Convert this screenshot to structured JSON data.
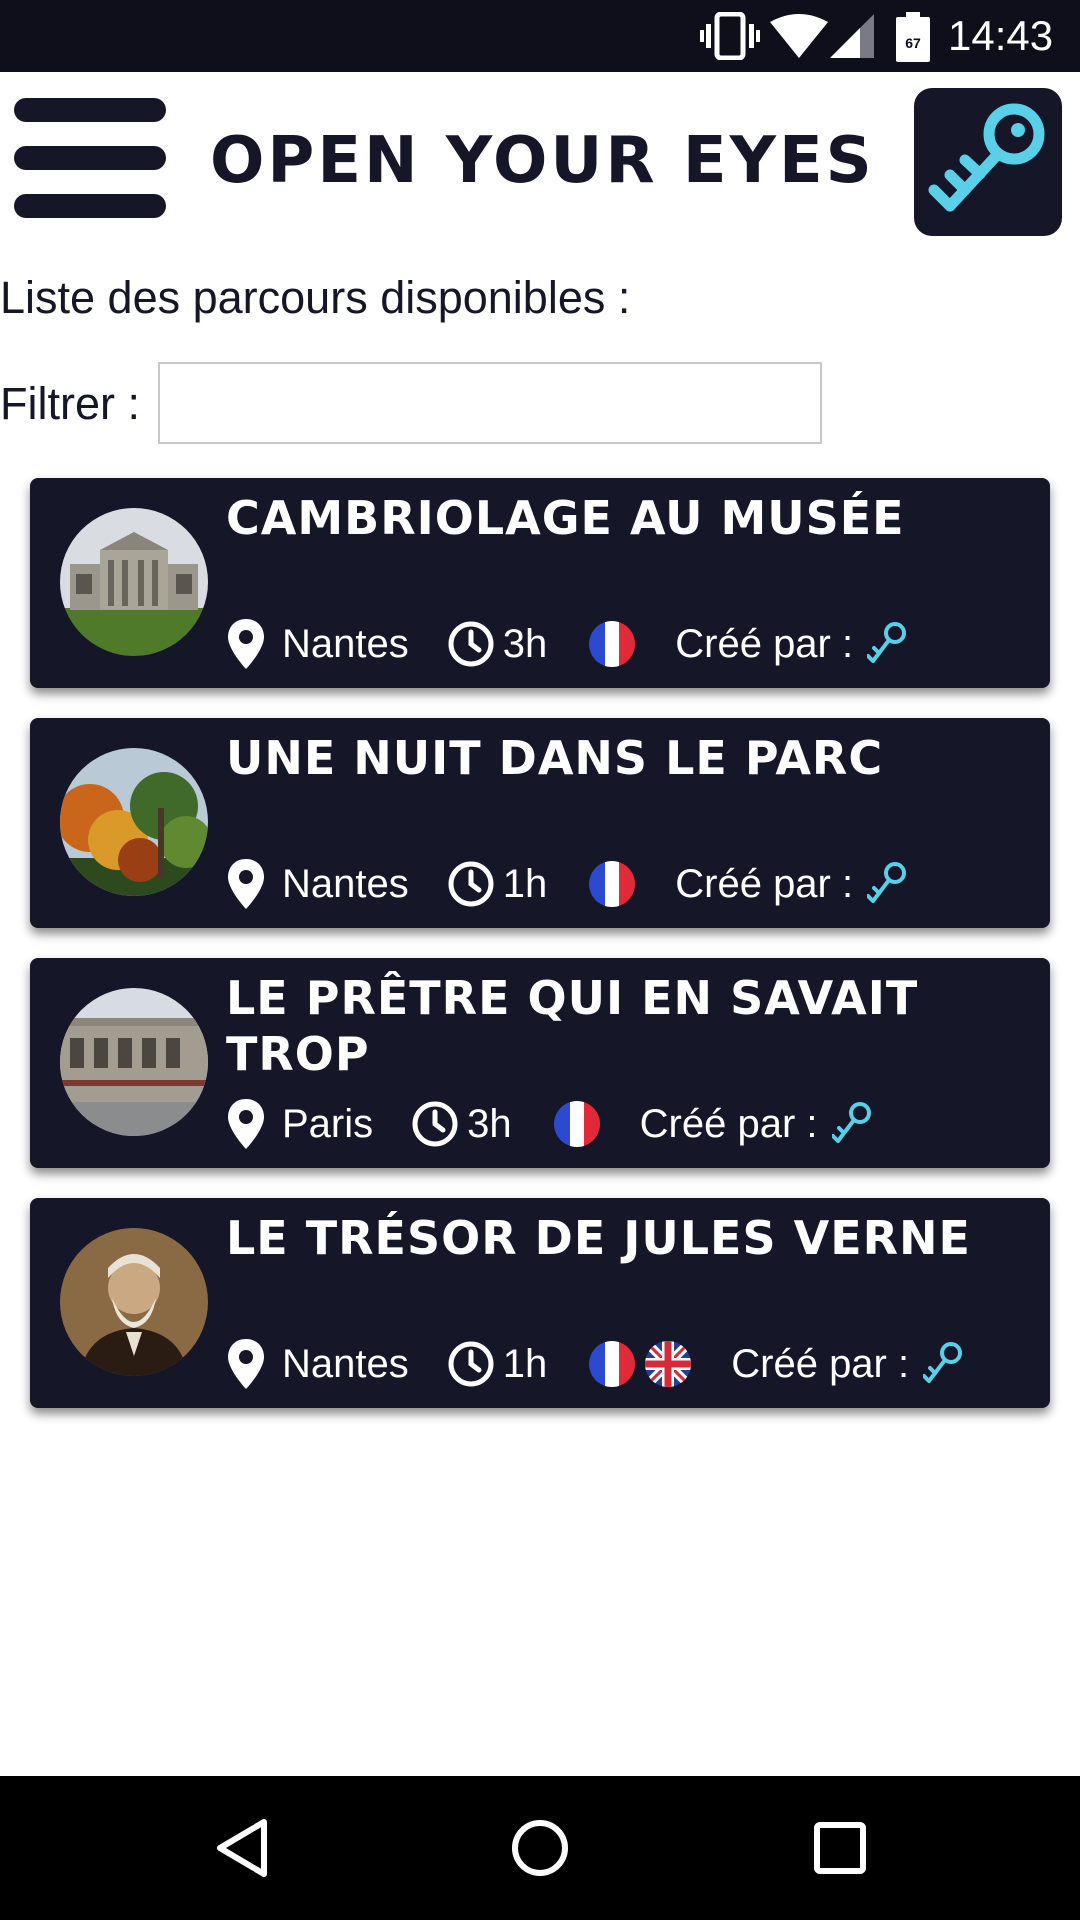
{
  "status_bar": {
    "time": "14:43",
    "battery_level": "67",
    "icons": [
      "vibrate-icon",
      "wifi-icon",
      "signal-icon",
      "battery-icon"
    ]
  },
  "header": {
    "title": "OPEN YOUR EYES",
    "menu_icon": "hamburger-menu-icon",
    "action_icon": "key-icon"
  },
  "list_heading": "Liste des parcours disponibles :",
  "filter": {
    "label": "Filtrer :",
    "value": "",
    "placeholder": ""
  },
  "routes": [
    {
      "title": "CAMBRIOLAGE AU MUSÉE",
      "city": "Nantes",
      "duration": "3h",
      "languages": [
        "fr"
      ],
      "created_by_label": "Créé par :",
      "image": "museum-building-photo"
    },
    {
      "title": "UNE NUIT DANS LE PARC",
      "city": "Nantes",
      "duration": "1h",
      "languages": [
        "fr"
      ],
      "created_by_label": "Créé par :",
      "image": "autumn-park-trees-photo"
    },
    {
      "title": "LE PRÊTRE QUI EN SAVAIT TROP",
      "city": "Paris",
      "duration": "3h",
      "languages": [
        "fr"
      ],
      "created_by_label": "Créé par :",
      "image": "paris-street-building-photo"
    },
    {
      "title": "LE TRÉSOR DE JULES VERNE",
      "city": "Nantes",
      "duration": "1h",
      "languages": [
        "fr",
        "en"
      ],
      "created_by_label": "Créé par :",
      "image": "jules-verne-portrait-photo"
    }
  ],
  "nav_bar": {
    "icons": [
      "back-icon",
      "home-icon",
      "recent-apps-icon"
    ]
  },
  "colors": {
    "primary_dark": "#161629",
    "accent_cyan": "#5ad0e8",
    "status_bar": "#0f0f1c",
    "nav_bar": "#000000",
    "background": "#ffffff"
  }
}
